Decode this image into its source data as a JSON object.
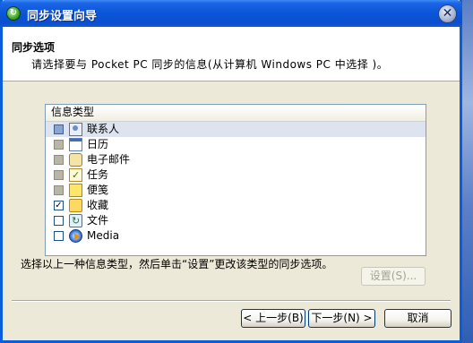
{
  "window": {
    "title": "同步设置向导",
    "app_icon": "sync-icon",
    "close_icon": "close-icon"
  },
  "header": {
    "title": "同步选项",
    "description": "请选择要与 Pocket PC 同步的信息(从计算机 Windows PC 中选择 )。"
  },
  "list": {
    "column_header": "信息类型",
    "items": [
      {
        "label": "联系人",
        "icon": "contacts-icon",
        "state": "partial",
        "selected": true
      },
      {
        "label": "日历",
        "icon": "calendar-icon",
        "state": "partial",
        "selected": false
      },
      {
        "label": "电子邮件",
        "icon": "email-icon",
        "state": "partial",
        "selected": false
      },
      {
        "label": "任务",
        "icon": "tasks-icon",
        "state": "partial",
        "selected": false
      },
      {
        "label": "便笺",
        "icon": "notes-icon",
        "state": "partial",
        "selected": false
      },
      {
        "label": "收藏",
        "icon": "favorites-icon",
        "state": "checked",
        "selected": false
      },
      {
        "label": "文件",
        "icon": "files-icon",
        "state": "unchecked",
        "selected": false
      },
      {
        "label": "Media",
        "icon": "media-icon",
        "state": "unchecked",
        "selected": false
      }
    ]
  },
  "hint": "选择以上一种信息类型，然后单击“设置”更改该类型的同步选项。",
  "buttons": {
    "settings": "设置(S)...",
    "back": "< 上一步(B)",
    "next": "下一步(N) >",
    "cancel": "取消"
  }
}
